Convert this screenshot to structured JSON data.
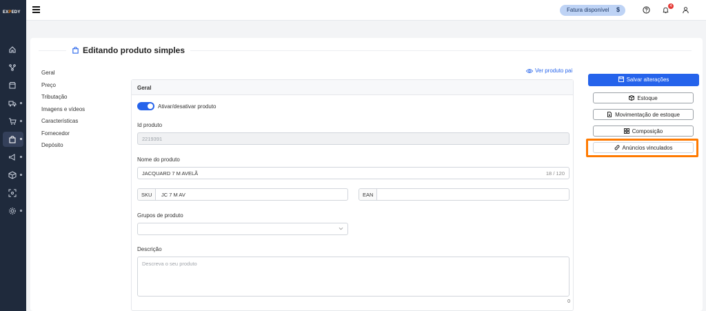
{
  "app": {
    "logo_text": "EXPEDY",
    "logo_prefix": "EX",
    "logo_mid": "P",
    "logo_rest": "EDY"
  },
  "topbar": {
    "fatura_label": "Fatura disponível",
    "fatura_symbol": "$",
    "notification_count": "4"
  },
  "page": {
    "title": "Editando produto simples",
    "ver_produto_pai": "Ver produto pai"
  },
  "nav": {
    "items": [
      "Geral",
      "Preço",
      "Tributação",
      "Imagens e vídeos",
      "Características",
      "Fornecedor",
      "Depósito"
    ]
  },
  "form": {
    "section_title": "Geral",
    "toggle_label": "Ativar/desativar produto",
    "toggle_on": true,
    "id_label": "Id produto",
    "id_value": "2219391",
    "nome_label": "Nome do produto",
    "nome_value": "JACQUARD 7 M AVELÃ",
    "nome_counter": "18 / 120",
    "sku_label": "SKU",
    "sku_value": "JC 7 M AV",
    "ean_label": "EAN",
    "ean_value": "",
    "grupos_label": "Grupos de produto",
    "descricao_label": "Descrição",
    "descricao_placeholder": "Descreva o seu produto",
    "descricao_counter": "0"
  },
  "actions": {
    "salvar": "Salvar alterações",
    "estoque": "Estoque",
    "movimentacao": "Movimentação de estoque",
    "composicao": "Composição",
    "anuncios": "Anúncios vinculados"
  },
  "colors": {
    "sidebar": "#1f2a3c",
    "primary": "#2563eb",
    "highlight": "#ff7a00",
    "fatura_bg": "#bed3f5"
  }
}
